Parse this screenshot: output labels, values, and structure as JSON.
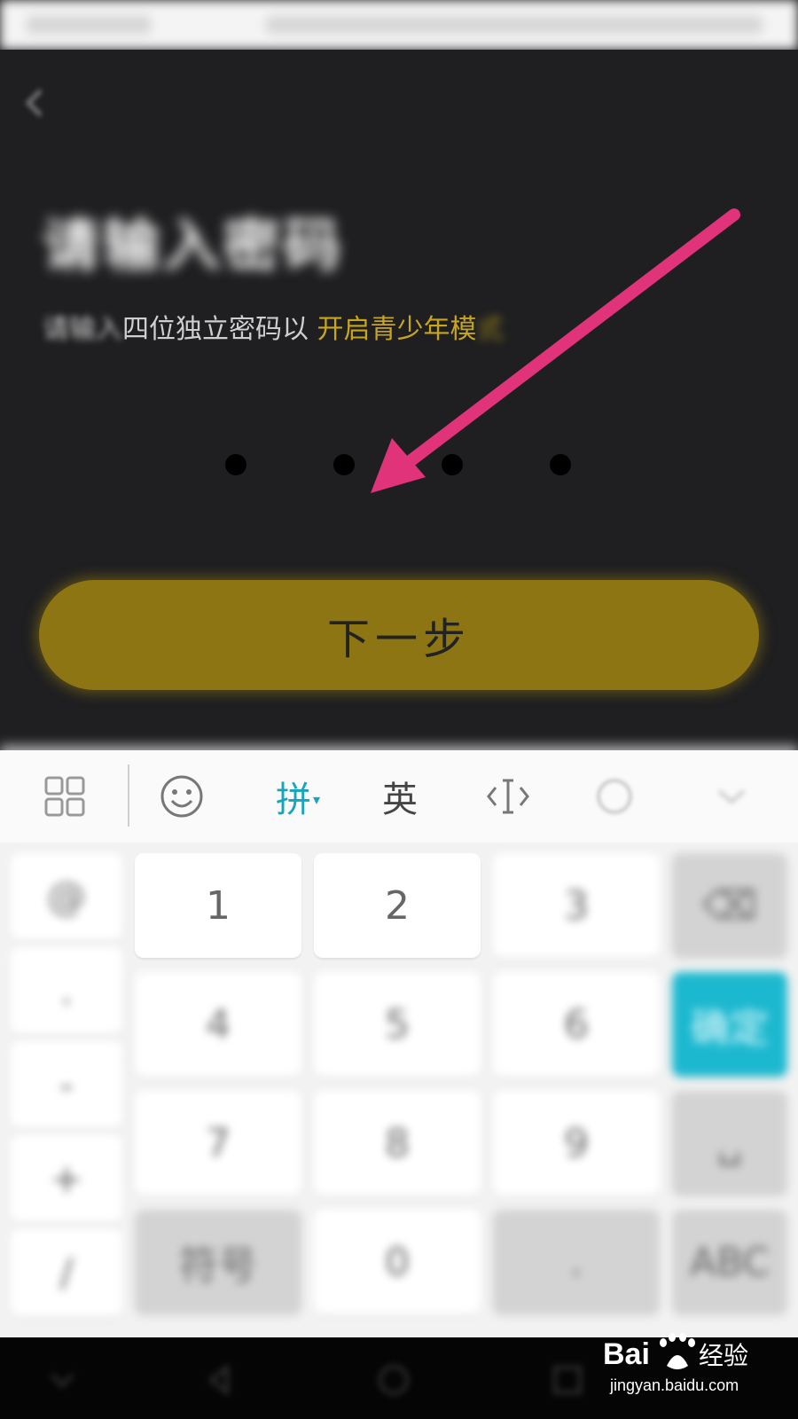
{
  "header": {
    "title": "请输入密码",
    "subtitle_blurred": "请输入",
    "subtitle_text": "四位独立密码以",
    "subtitle_accent": "开启青少年模",
    "subtitle_accent_tail": "式"
  },
  "password": {
    "length": 4,
    "filled": 0
  },
  "next_button_label": "下一步",
  "keyboard": {
    "toolbar": {
      "grid": "grid-icon",
      "emoji": "smiley-icon",
      "pinyin": "拼",
      "pinyin_caret": "▾",
      "english": "英",
      "cursor": "cursor-move-icon",
      "voice": "circle-icon",
      "collapse": "chevron-down-icon"
    },
    "keys": {
      "k1": "1",
      "k2": "2",
      "k3": "3",
      "k4": "4",
      "k5": "5",
      "k6": "6",
      "k7": "7",
      "k8": "8",
      "k9": "9",
      "k0": "0",
      "side1": "@",
      "side2": ".",
      "side3": "-",
      "side4": "+",
      "side5": "/",
      "symbol": "符号",
      "dot": ".",
      "abc": "ABC",
      "delete": "⌫",
      "enter": "确定",
      "space": "␣"
    }
  },
  "watermark": {
    "brand": "Bai 经验",
    "url": "jingyan.baidu.com"
  },
  "colors": {
    "accent": "#c7a51d",
    "button": "#8c7512",
    "arrow": "#e0337a",
    "kb_accent": "#1cb8cf"
  }
}
